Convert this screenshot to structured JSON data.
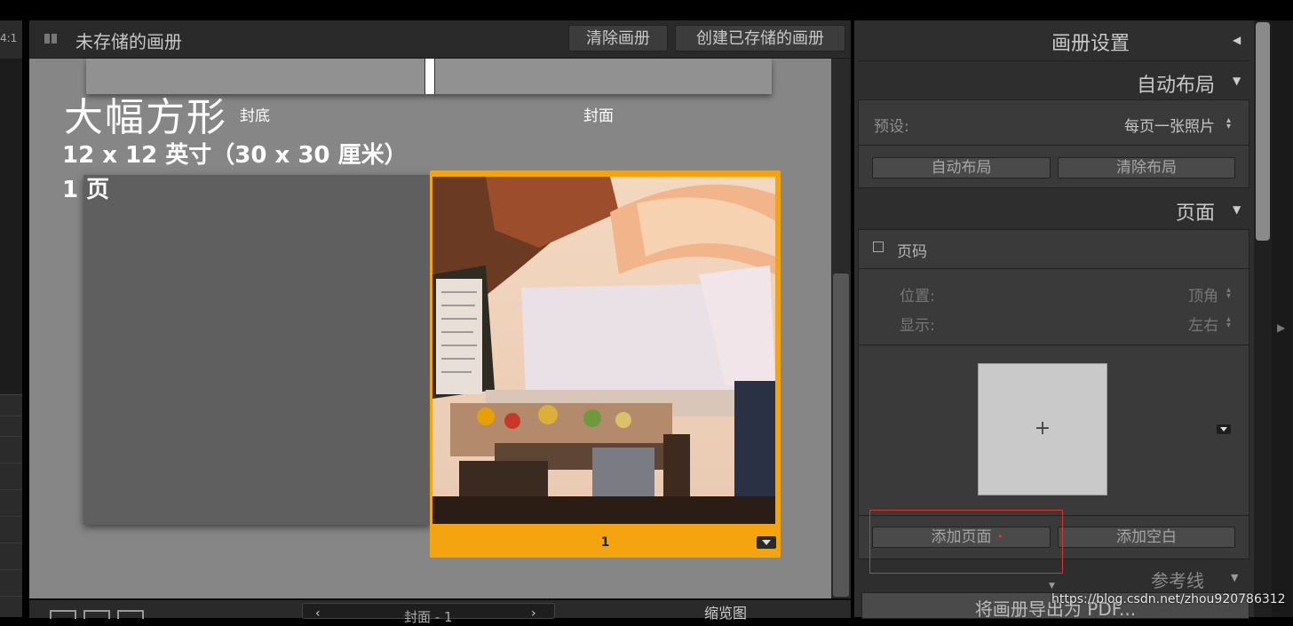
{
  "left": {
    "ratio": "4:1"
  },
  "header": {
    "title": "未存储的画册",
    "clear_button": "清除画册",
    "create_button": "创建已存储的画册"
  },
  "canvas": {
    "back_label": "封底",
    "front_label": "封面",
    "book_type": "大幅方形",
    "book_size": "12 x 12 英寸（30 x 30 厘米）",
    "page_count": "1 页",
    "page_number": "1",
    "accent": "#f4a40e"
  },
  "bottom_bar": {
    "prev": "‹",
    "next": "›",
    "nav_label": "封面 - 1",
    "thumbnail_label": "缩览图"
  },
  "right_panel": {
    "book_settings": "画册设置",
    "auto_layout": {
      "title": "自动布局",
      "preset_label": "预设:",
      "preset_value": "每页一张照片",
      "auto_layout_button": "自动布局",
      "clear_layout_button": "清除布局"
    },
    "page": {
      "title": "页面",
      "page_number_label": "页码",
      "position_label": "位置:",
      "position_value": "顶角",
      "display_label": "显示:",
      "display_value": "左右",
      "template_plus": "+",
      "add_page_button": "添加页面",
      "add_blank_button": "添加空白",
      "red_dot": "•"
    },
    "guides": {
      "title": "参考线"
    },
    "export_button": "将画册导出为 PDF..."
  },
  "watermark": "https://blog.csdn.net/zhou920786312"
}
